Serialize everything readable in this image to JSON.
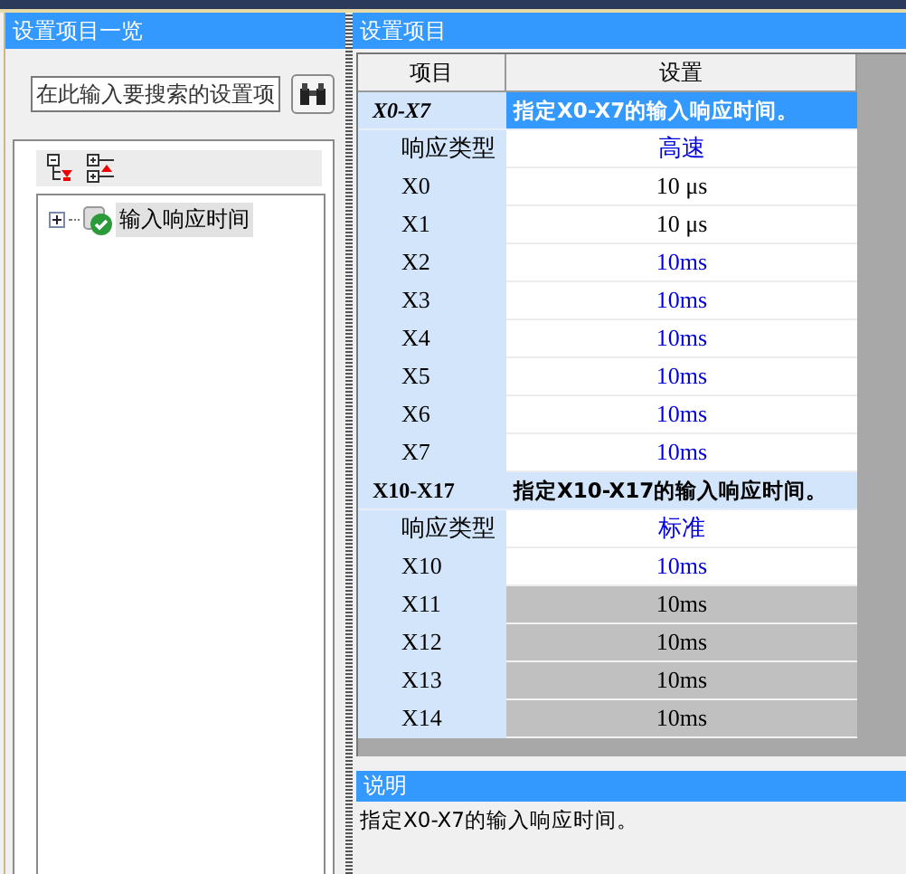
{
  "left_panel": {
    "title": "设置项目一览",
    "search": {
      "placeholder": "在此输入要搜索的设置项"
    },
    "tree": [
      {
        "label": "输入响应时间",
        "expanded": false,
        "selected": true
      }
    ]
  },
  "right_panel": {
    "title": "设置项目",
    "table": {
      "columns": [
        "项目",
        "设置"
      ],
      "groups": [
        {
          "name": "X0-X7",
          "description": "指定X0-X7的输入响应时间。",
          "selected": true,
          "rows": [
            {
              "label": "响应类型",
              "value": "高速",
              "changed": true,
              "disabled": false
            },
            {
              "label": "X0",
              "value": "10 μs",
              "changed": false,
              "disabled": false
            },
            {
              "label": "X1",
              "value": "10 μs",
              "changed": false,
              "disabled": false
            },
            {
              "label": "X2",
              "value": "10ms",
              "changed": true,
              "disabled": false
            },
            {
              "label": "X3",
              "value": "10ms",
              "changed": true,
              "disabled": false
            },
            {
              "label": "X4",
              "value": "10ms",
              "changed": true,
              "disabled": false
            },
            {
              "label": "X5",
              "value": "10ms",
              "changed": true,
              "disabled": false
            },
            {
              "label": "X6",
              "value": "10ms",
              "changed": true,
              "disabled": false
            },
            {
              "label": "X7",
              "value": "10ms",
              "changed": true,
              "disabled": false
            }
          ]
        },
        {
          "name": "X10-X17",
          "description": "指定X10-X17的输入响应时间。",
          "selected": false,
          "rows": [
            {
              "label": "响应类型",
              "value": "标准",
              "changed": true,
              "disabled": false
            },
            {
              "label": "X10",
              "value": "10ms",
              "changed": true,
              "disabled": false
            },
            {
              "label": "X11",
              "value": "10ms",
              "changed": false,
              "disabled": true
            },
            {
              "label": "X12",
              "value": "10ms",
              "changed": false,
              "disabled": true
            },
            {
              "label": "X13",
              "value": "10ms",
              "changed": false,
              "disabled": true
            },
            {
              "label": "X14",
              "value": "10ms",
              "changed": false,
              "disabled": true
            }
          ]
        }
      ]
    }
  },
  "description": {
    "title": "说明",
    "text": "指定X0-X7的输入响应时间。"
  }
}
